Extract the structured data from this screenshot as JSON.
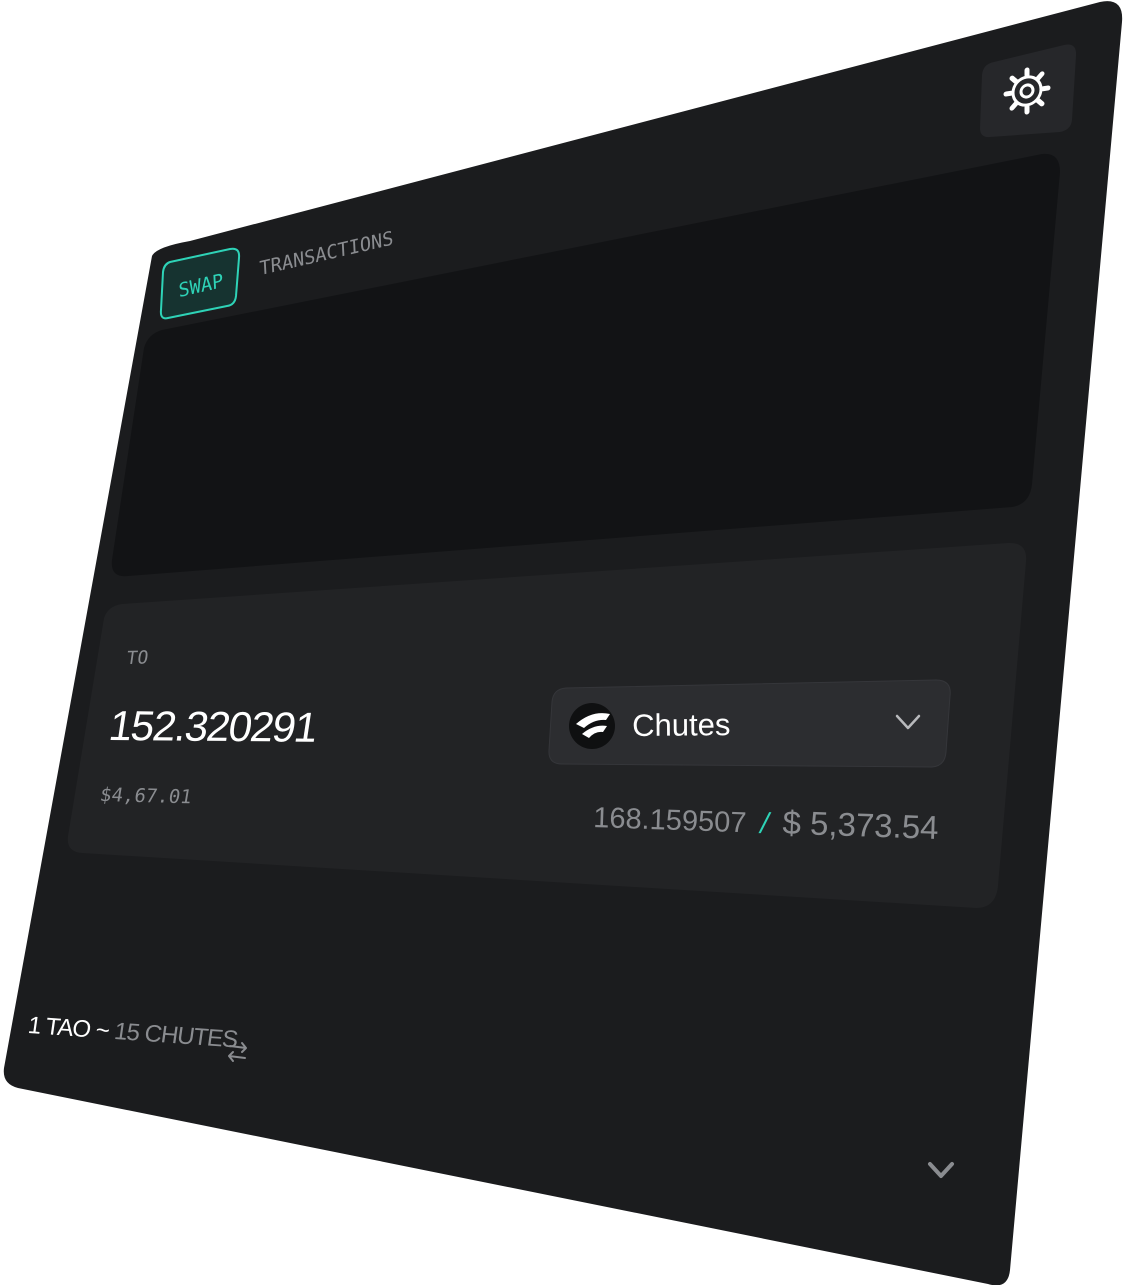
{
  "header": {
    "settings_icon": "gear-icon"
  },
  "tabs": [
    {
      "label": "SWAP",
      "active": true
    },
    {
      "label": "TRANSACTIONS",
      "active": false
    }
  ],
  "to_panel": {
    "label": "TO",
    "amount": "152.320291",
    "usd_value": "$4,67.01",
    "token": {
      "name": "Chutes",
      "icon": "chutes-logo-icon",
      "dropdown_icon": "chevron-down-icon"
    },
    "balance": "168.159507",
    "balance_separator": "/",
    "balance_usd": "$ 5,373.54"
  },
  "rate": {
    "base": "1 TAO ~",
    "quote": "15 CHUTES",
    "swap_icon": "swap-arrows-icon"
  },
  "footer": {
    "expand_icon": "chevron-down-icon"
  },
  "colors": {
    "accent": "#2ed3b7",
    "card_bg": "#1b1c1e",
    "panel_bg": "#121315",
    "to_panel_bg": "#222325",
    "text_primary": "#ffffff",
    "text_secondary": "#8a8c90"
  }
}
